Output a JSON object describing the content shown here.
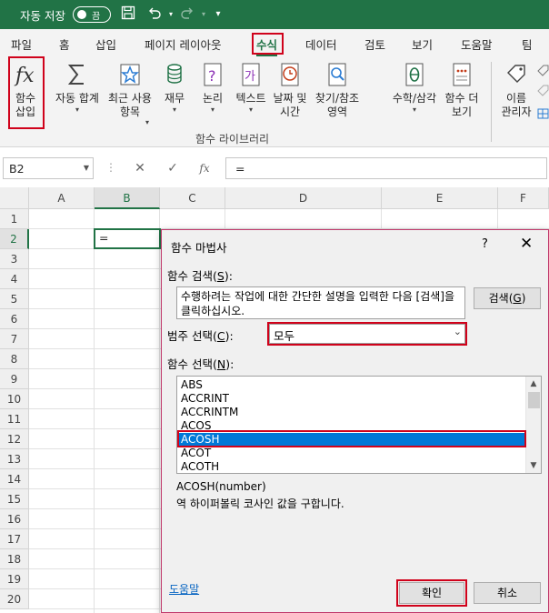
{
  "titlebar": {
    "autosave_label": "자동 저장",
    "autosave_state": "끔",
    "color": "#217346"
  },
  "menu": {
    "tabs": [
      "파일",
      "홈",
      "삽입",
      "페이지 레이아웃",
      "수식",
      "데이터",
      "검토",
      "보기",
      "도움말",
      "팀"
    ],
    "active": "수식"
  },
  "ribbon": {
    "insert_function": {
      "line1": "함수",
      "line2": "삽입"
    },
    "autosum": {
      "line1": "자동 합계"
    },
    "recent": {
      "line1": "최근 사용",
      "line2": "항목"
    },
    "financial": {
      "line1": "재무"
    },
    "logical": {
      "line1": "논리"
    },
    "text": {
      "line1": "텍스트"
    },
    "datetime": {
      "line1": "날짜 및",
      "line2": "시간"
    },
    "lookup": {
      "line1": "찾기/참조",
      "line2": "영역"
    },
    "math": {
      "line1": "수학/삼각"
    },
    "more": {
      "line1": "함수 더",
      "line2": "보기"
    },
    "name_manager": {
      "line1": "이름",
      "line2": "관리자"
    },
    "group_label": "함수 라이브러리"
  },
  "formula_bar": {
    "name_box": "B2",
    "fx_label": "fx",
    "content": "="
  },
  "sheet": {
    "columns": [
      "A",
      "B",
      "C",
      "D",
      "E",
      "F"
    ],
    "rows": [
      "1",
      "2",
      "3",
      "4",
      "5",
      "6",
      "7",
      "8",
      "9",
      "10",
      "11",
      "12",
      "13",
      "14",
      "15",
      "16",
      "17",
      "18",
      "19",
      "20"
    ],
    "active_cell_value": "="
  },
  "dialog": {
    "title": "함수 마법사",
    "help_glyph": "?",
    "close_glyph": "✕",
    "search_label": "함수 검색",
    "search_hotkey": "S",
    "search_text": "수행하려는 작업에 대한 간단한 설명을 입력한 다음 [검색]을 클릭하십시오.",
    "search_button": "검색",
    "search_button_hotkey": "G",
    "category_label": "범주 선택",
    "category_hotkey": "C",
    "category_value": "모두",
    "function_label": "함수 선택",
    "function_hotkey": "N",
    "functions": [
      "ABS",
      "ACCRINT",
      "ACCRINTM",
      "ACOS",
      "ACOSH",
      "ACOT",
      "ACOTH"
    ],
    "selected_function": "ACOSH",
    "syntax": "ACOSH(number)",
    "description": "역 하이퍼볼릭 코사인 값을 구합니다.",
    "help_link": "도움말",
    "ok_button": "확인",
    "cancel_button": "취소"
  }
}
